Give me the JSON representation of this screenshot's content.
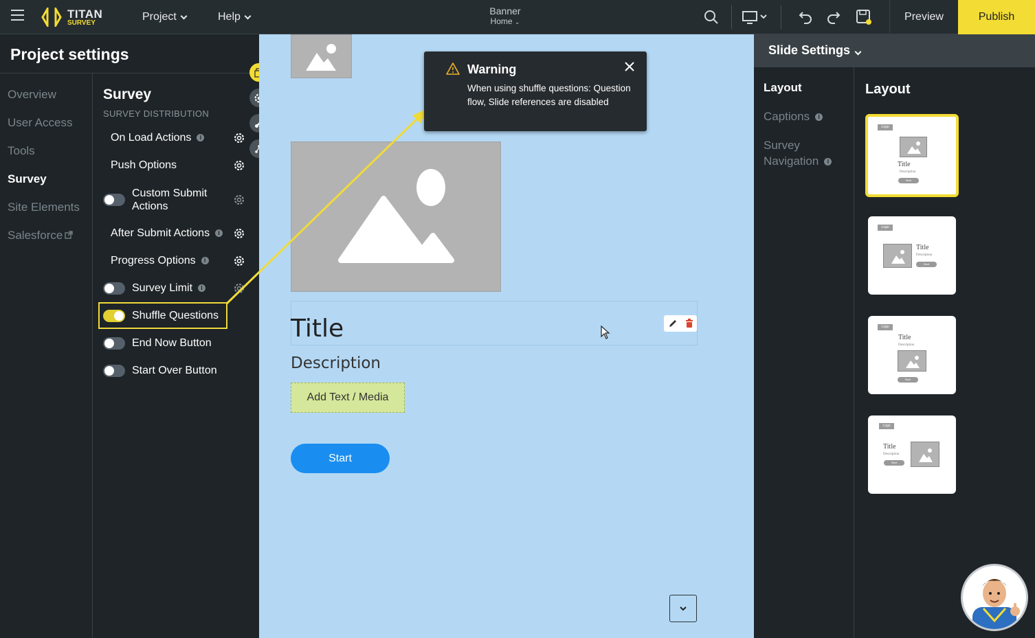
{
  "topbar": {
    "logo_title": "TITAN",
    "logo_sub": "SURVEY",
    "menu_project": "Project",
    "menu_help": "Help",
    "page_name": "Banner",
    "page_sub": "Home",
    "preview": "Preview",
    "publish": "Publish",
    "accent": "#f3dc33"
  },
  "left": {
    "title": "Project settings",
    "nav": [
      "Overview",
      "User Access",
      "Tools",
      "Survey",
      "Site Elements",
      "Salesforce"
    ],
    "active": "Survey",
    "section_title": "Survey",
    "section_sub": "SURVEY DISTRIBUTION",
    "options": {
      "on_load": "On Load Actions",
      "push": "Push Options",
      "custom_submit": "Custom Submit Actions",
      "after_submit": "After Submit Actions",
      "progress": "Progress Options",
      "survey_limit": "Survey Limit",
      "shuffle": "Shuffle Questions",
      "end_now": "End Now Button",
      "start_over": "Start Over Button"
    },
    "toggles": {
      "custom_submit": false,
      "survey_limit": false,
      "shuffle": true,
      "end_now": false,
      "start_over": false
    }
  },
  "canvas": {
    "title": "Title",
    "description": "Description",
    "add_media": "Add Text / Media",
    "start": "Start",
    "background": "#b4d8f4"
  },
  "warning": {
    "title": "Warning",
    "text": "When using shuffle questions: Question flow, Slide references are disabled"
  },
  "right": {
    "header": "Slide Settings",
    "nav": [
      "Layout",
      "Captions",
      "Survey Navigation"
    ],
    "active": "Layout",
    "layout_title": "Layout",
    "thumb_logo": "Logo",
    "thumb_title": "Title",
    "thumb_desc": "Description",
    "thumb_start": "Start",
    "selected_layout": 1
  }
}
